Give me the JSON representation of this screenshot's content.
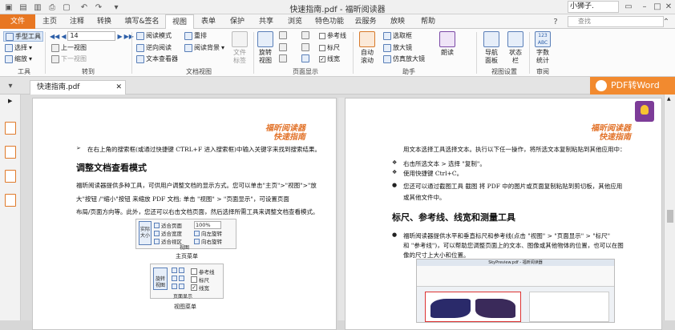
{
  "titlebar": {
    "title": "快速指南.pdf - 福昕阅读器",
    "user": "小狮子."
  },
  "menu": {
    "tabs": [
      "文件",
      "主页",
      "注释",
      "转换",
      "填写&签名",
      "视图",
      "表单",
      "保护",
      "共享",
      "浏览",
      "特色功能",
      "云服务",
      "放映",
      "帮助"
    ],
    "active": "视图",
    "search_placeholder": "查找"
  },
  "ribbon": {
    "tools": {
      "hand": "手型工具",
      "select": "选择",
      "zoom": "缩放",
      "label": "工具"
    },
    "goto": {
      "first_label": "上一视图",
      "page_value": "14",
      "prev_view": "下一视图",
      "label": "转到"
    },
    "docview": {
      "read_mode": "阅读模式",
      "reverse_read": "逆向阅读",
      "text_viewer": "文本查看器",
      "reflow": "重排",
      "read_bg": "阅读背景",
      "doc_props": "文件\n标签",
      "label": "文档视图"
    },
    "pagedisplay": {
      "rotate": "旋转\n视图",
      "ref_line": "参考线",
      "ruler": "标尺",
      "linewidth": "线宽",
      "label": "页面显示"
    },
    "assistant": {
      "select_text": "选取框",
      "magnifier": "放大镜",
      "loupe": "仿真放大镜",
      "auto_scroll": "自动\n滚动",
      "read_aloud": "朗读",
      "label": "助手"
    },
    "viewsettings": {
      "nav_panel": "导航\n面板",
      "status_bar": "状态\n栏",
      "label": "视图设置"
    },
    "review": {
      "word_count": "字数\n统计",
      "label": "审阅"
    }
  },
  "doc": {
    "tab_name": "快速指南.pdf",
    "pdf_to_word": "PDF转Word"
  },
  "page_left": {
    "header1": "福昕阅读器",
    "header2": "快速指南",
    "line1": "在右上角的搜索框(或通过快捷键 CTRL+F 进入搜索框)中输入关键字来找到搜索结果。",
    "heading": "调整文档查看模式",
    "p1": "福昕阅读器提供多种工具，可供用户调整文档的显示方式。您可以单击\"主页\">\"视图\">\"放",
    "p2": "大\"按钮     /\"缩小\"按钮     来缩放 PDF 文档; 单击 \"视图\" > \"页面显示\"，可设置页面",
    "p3": "布局/页面方向等。此外，您还可以右击文档页面，然后选择所需工具来调整文档查看模式。",
    "fig1_items": [
      "适合页面",
      "适合宽度",
      "适合视区"
    ],
    "fig1_zoom": "100%",
    "fig1_rot1": "向左旋转",
    "fig1_rot2": "向右旋转",
    "fig1_btn": "实际\n大小",
    "fig1_sub": "视图",
    "fig1_caption": "主页菜单",
    "fig2_items": [
      "参考线",
      "标尺",
      "线宽"
    ],
    "fig2_btn": "旋转\n视图",
    "fig2_sub": "页面显示",
    "fig2_caption": "视图菜单"
  },
  "page_right": {
    "header1": "福昕阅读器",
    "header2": "快速指南",
    "l1": "用文本选择工具选择文本。执行以下任一操作，将所选文本复制粘贴到其他应用中：",
    "b1": "右击所选文本 > 选择 \"复制\"。",
    "b2": "使用快捷键 Ctrl+C。",
    "b3": "您还可以通过截图工具     截图 将 PDF 中的图片或页面复制粘贴到剪切板，其他应用",
    "b3b": "或其他文件中。",
    "heading": "标尺、参考线、线宽和测量工具",
    "p1": "福昕阅读器提供水平和垂直标尺和参考线(点击 \"视图\" > \"页面显示\" > \"标尺\"",
    "p2": "和 \"参考线\")，可以帮助您调整页面上的文本、图像或其他物体的位置，也可以在图",
    "p3": "像的尺寸上大小和位置。",
    "fig_title": "SkyPreview.pdf - 福昕阅读器"
  }
}
